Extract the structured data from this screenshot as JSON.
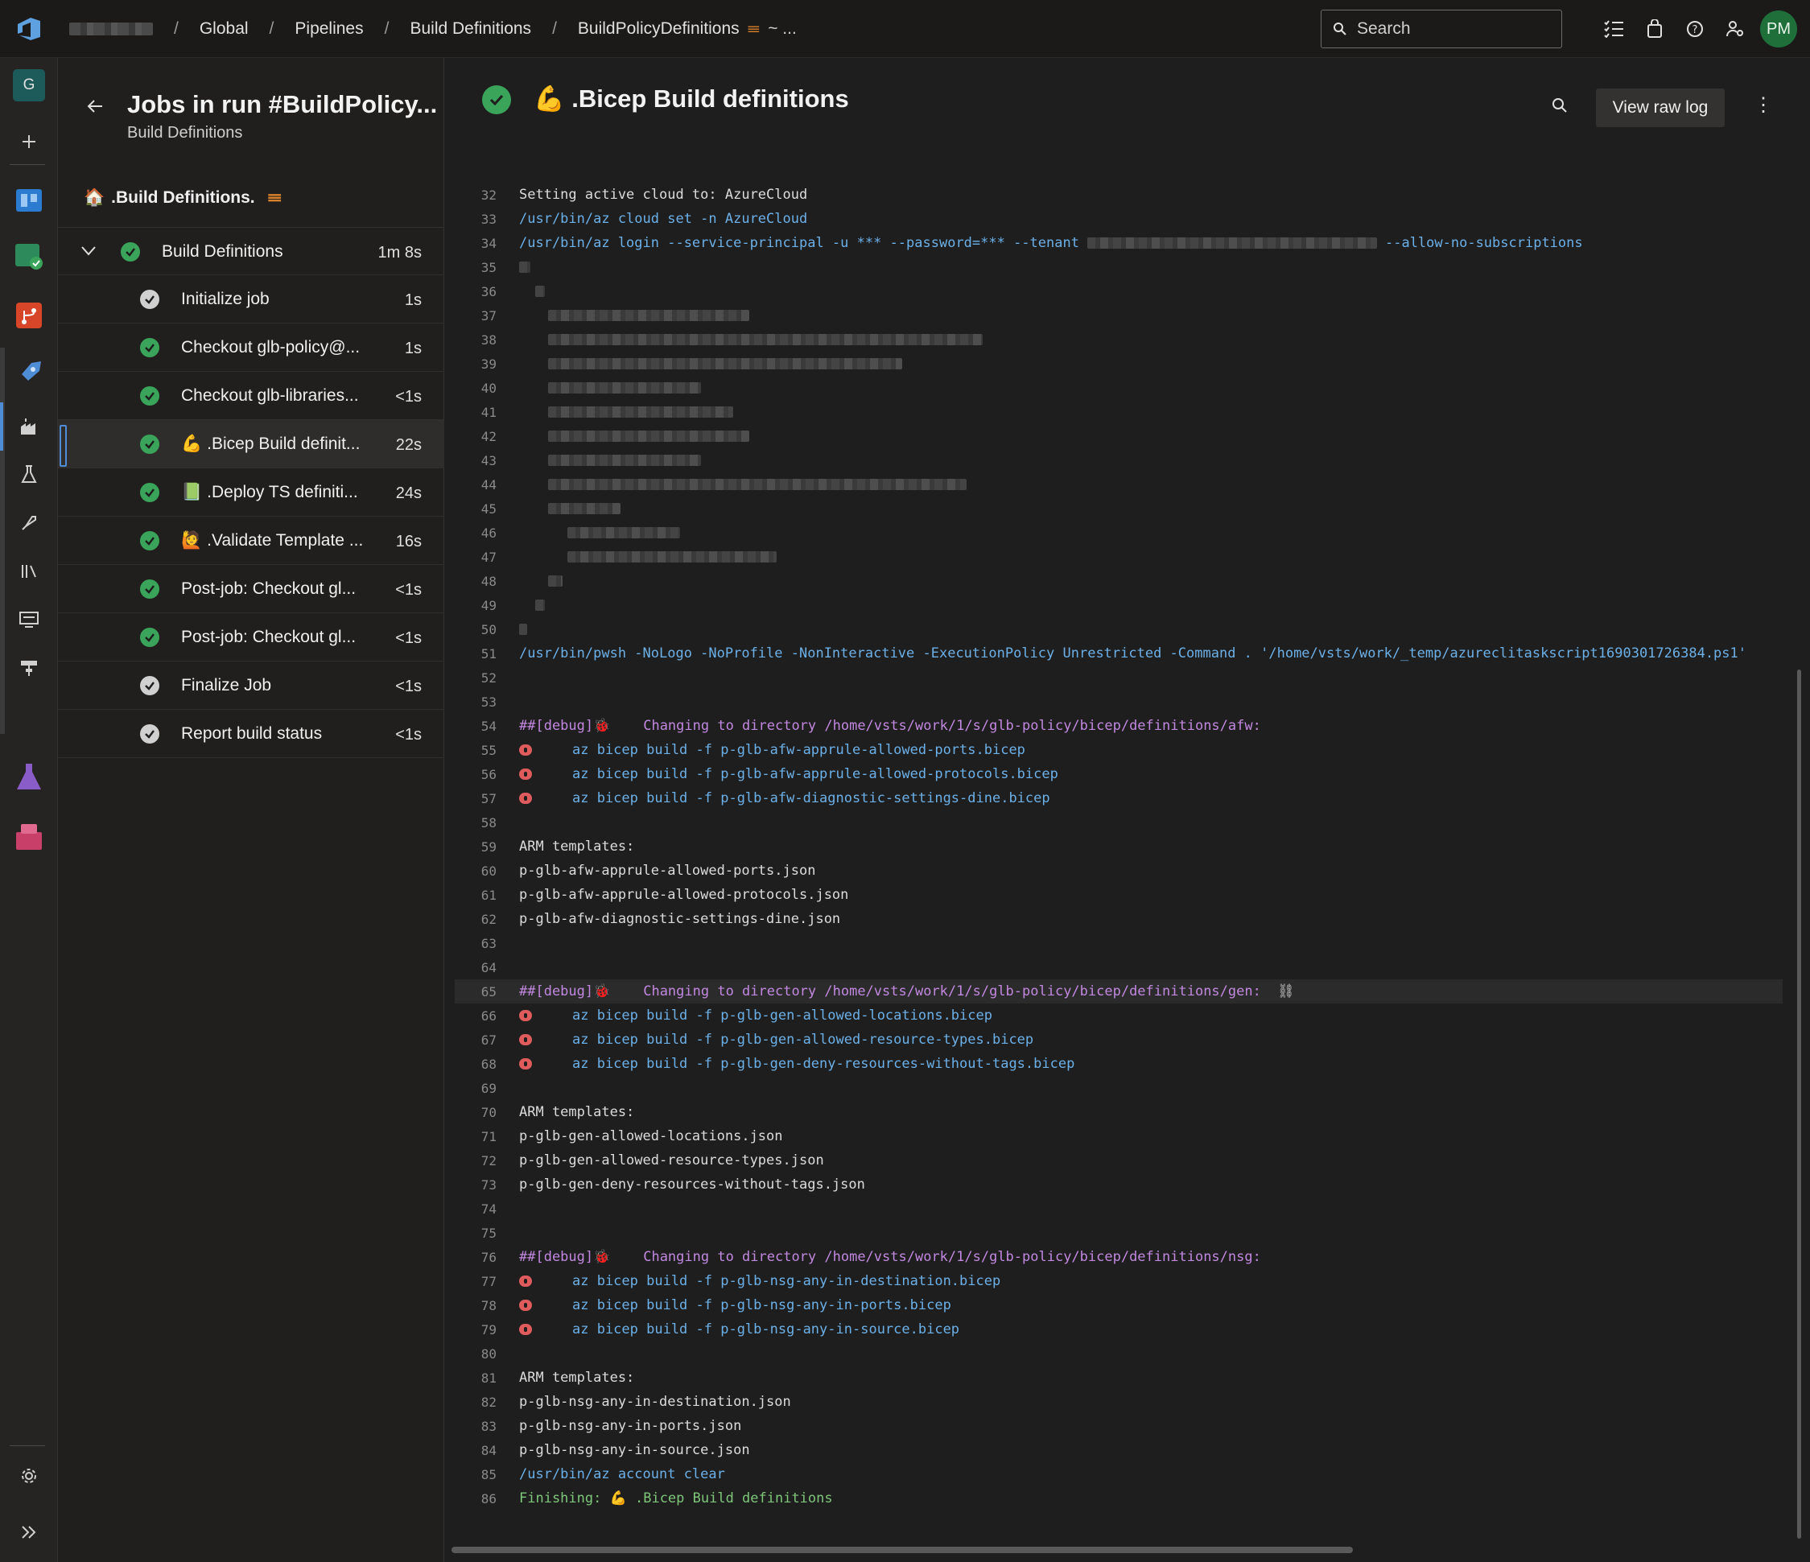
{
  "topbar": {
    "breadcrumb": [
      "Global",
      "Pipelines",
      "Build Definitions",
      "BuildPolicyDefinitions"
    ],
    "breadcrumb_more": "~ ...",
    "search_placeholder": "Search",
    "avatar_initials": "PM"
  },
  "rail": {
    "org_initial": "G",
    "icons": [
      "plus-icon",
      "boards-icon",
      "test-plans-icon",
      "repos-icon",
      "pipelines-icon",
      "builds-icon",
      "testing-icon",
      "releases-icon",
      "library-icon",
      "task-groups-icon",
      "deployment-groups-icon",
      "test-plans-flask-icon",
      "artifacts-icon",
      "settings-icon",
      "expand-icon"
    ]
  },
  "jobs": {
    "title": "Jobs in run #BuildPolicy...",
    "subtitle": "Build Definitions",
    "stage_label": ".Build Definitions.",
    "stage_emoji": "🏠",
    "group": {
      "label": "Build Definitions",
      "duration": "1m 8s"
    },
    "items": [
      {
        "label": "Initialize job",
        "duration": "1s",
        "status": "grey",
        "emoji": ""
      },
      {
        "label": "Checkout glb-policy@...",
        "duration": "1s",
        "status": "green",
        "emoji": ""
      },
      {
        "label": "Checkout glb-libraries...",
        "duration": "<1s",
        "status": "green",
        "emoji": ""
      },
      {
        "label": ".Bicep Build definit...",
        "duration": "22s",
        "status": "green",
        "emoji": "💪"
      },
      {
        "label": ".Deploy TS definiti...",
        "duration": "24s",
        "status": "green",
        "emoji": "📗"
      },
      {
        "label": ".Validate Template ...",
        "duration": "16s",
        "status": "green",
        "emoji": "🙋"
      },
      {
        "label": "Post-job: Checkout gl...",
        "duration": "<1s",
        "status": "green",
        "emoji": ""
      },
      {
        "label": "Post-job: Checkout gl...",
        "duration": "<1s",
        "status": "green",
        "emoji": ""
      },
      {
        "label": "Finalize Job",
        "duration": "<1s",
        "status": "grey",
        "emoji": ""
      },
      {
        "label": "Report build status",
        "duration": "<1s",
        "status": "grey",
        "emoji": ""
      }
    ]
  },
  "log": {
    "title": ".Bicep Build definitions",
    "title_emoji": "💪",
    "raw_button": "View raw log",
    "lines": [
      {
        "n": "32",
        "t": "Setting active cloud to: AzureCloud",
        "k": "plain"
      },
      {
        "n": "33",
        "t": "/usr/bin/az cloud set -n AzureCloud",
        "k": "cmd"
      },
      {
        "n": "34",
        "t": "/usr/bin/az login --service-principal -u *** --password=*** --tenant",
        "k": "cmd",
        "tail": "--allow-no-subscriptions"
      },
      {
        "n": "35",
        "t": "",
        "k": "blur"
      },
      {
        "n": "36",
        "t": "",
        "k": "blur"
      },
      {
        "n": "37",
        "t": "",
        "k": "blur"
      },
      {
        "n": "38",
        "t": "",
        "k": "blur"
      },
      {
        "n": "39",
        "t": "",
        "k": "blur"
      },
      {
        "n": "40",
        "t": "",
        "k": "blur"
      },
      {
        "n": "41",
        "t": "",
        "k": "blur"
      },
      {
        "n": "42",
        "t": "",
        "k": "blur"
      },
      {
        "n": "43",
        "t": "",
        "k": "blur"
      },
      {
        "n": "44",
        "t": "",
        "k": "blur"
      },
      {
        "n": "45",
        "t": "",
        "k": "blur"
      },
      {
        "n": "46",
        "t": "",
        "k": "blur"
      },
      {
        "n": "47",
        "t": "",
        "k": "blur"
      },
      {
        "n": "48",
        "t": "",
        "k": "blur"
      },
      {
        "n": "49",
        "t": "",
        "k": "blur"
      },
      {
        "n": "50",
        "t": "",
        "k": "blur"
      },
      {
        "n": "51",
        "t": "/usr/bin/pwsh -NoLogo -NoProfile -NonInteractive -ExecutionPolicy Unrestricted -Command . '/home/vsts/work/_temp/azureclitaskscript1690301726384.ps1'",
        "k": "cmd"
      },
      {
        "n": "52",
        "t": "",
        "k": "plain"
      },
      {
        "n": "53",
        "t": "",
        "k": "plain"
      },
      {
        "n": "54",
        "t": "##[debug]🐞    Changing to directory /home/vsts/work/1/s/glb-policy/bicep/definitions/afw:",
        "k": "dbg"
      },
      {
        "n": "55",
        "t": "az bicep build -f p-glb-afw-apprule-allowed-ports.bicep",
        "k": "err"
      },
      {
        "n": "56",
        "t": "az bicep build -f p-glb-afw-apprule-allowed-protocols.bicep",
        "k": "err"
      },
      {
        "n": "57",
        "t": "az bicep build -f p-glb-afw-diagnostic-settings-dine.bicep",
        "k": "err"
      },
      {
        "n": "58",
        "t": "",
        "k": "plain"
      },
      {
        "n": "59",
        "t": "ARM templates:",
        "k": "plain"
      },
      {
        "n": "60",
        "t": "p-glb-afw-apprule-allowed-ports.json",
        "k": "plain"
      },
      {
        "n": "61",
        "t": "p-glb-afw-apprule-allowed-protocols.json",
        "k": "plain"
      },
      {
        "n": "62",
        "t": "p-glb-afw-diagnostic-settings-dine.json",
        "k": "plain"
      },
      {
        "n": "63",
        "t": "",
        "k": "plain"
      },
      {
        "n": "64",
        "t": "",
        "k": "plain"
      },
      {
        "n": "65",
        "t": "##[debug]🐞    Changing to directory /home/vsts/work/1/s/glb-policy/bicep/definitions/gen:",
        "k": "dbg",
        "highlight": true
      },
      {
        "n": "66",
        "t": "az bicep build -f p-glb-gen-allowed-locations.bicep",
        "k": "err"
      },
      {
        "n": "67",
        "t": "az bicep build -f p-glb-gen-allowed-resource-types.bicep",
        "k": "err"
      },
      {
        "n": "68",
        "t": "az bicep build -f p-glb-gen-deny-resources-without-tags.bicep",
        "k": "err"
      },
      {
        "n": "69",
        "t": "",
        "k": "plain"
      },
      {
        "n": "70",
        "t": "ARM templates:",
        "k": "plain"
      },
      {
        "n": "71",
        "t": "p-glb-gen-allowed-locations.json",
        "k": "plain"
      },
      {
        "n": "72",
        "t": "p-glb-gen-allowed-resource-types.json",
        "k": "plain"
      },
      {
        "n": "73",
        "t": "p-glb-gen-deny-resources-without-tags.json",
        "k": "plain"
      },
      {
        "n": "74",
        "t": "",
        "k": "plain"
      },
      {
        "n": "75",
        "t": "",
        "k": "plain"
      },
      {
        "n": "76",
        "t": "##[debug]🐞    Changing to directory /home/vsts/work/1/s/glb-policy/bicep/definitions/nsg:",
        "k": "dbg"
      },
      {
        "n": "77",
        "t": "az bicep build -f p-glb-nsg-any-in-destination.bicep",
        "k": "err"
      },
      {
        "n": "78",
        "t": "az bicep build -f p-glb-nsg-any-in-ports.bicep",
        "k": "err"
      },
      {
        "n": "79",
        "t": "az bicep build -f p-glb-nsg-any-in-source.bicep",
        "k": "err"
      },
      {
        "n": "80",
        "t": "",
        "k": "plain"
      },
      {
        "n": "81",
        "t": "ARM templates:",
        "k": "plain"
      },
      {
        "n": "82",
        "t": "p-glb-nsg-any-in-destination.json",
        "k": "plain"
      },
      {
        "n": "83",
        "t": "p-glb-nsg-any-in-ports.json",
        "k": "plain"
      },
      {
        "n": "84",
        "t": "p-glb-nsg-any-in-source.json",
        "k": "plain"
      },
      {
        "n": "85",
        "t": "/usr/bin/az account clear",
        "k": "cmd"
      },
      {
        "n": "86",
        "t": "Finishing: 💪 .Bicep Build definitions",
        "k": "fin"
      }
    ]
  },
  "colors": {
    "accent": "#4f8cd6",
    "success": "#3aa55a",
    "command": "#6cb0e8",
    "debug": "#c288e0",
    "error": "#e05c5c"
  }
}
